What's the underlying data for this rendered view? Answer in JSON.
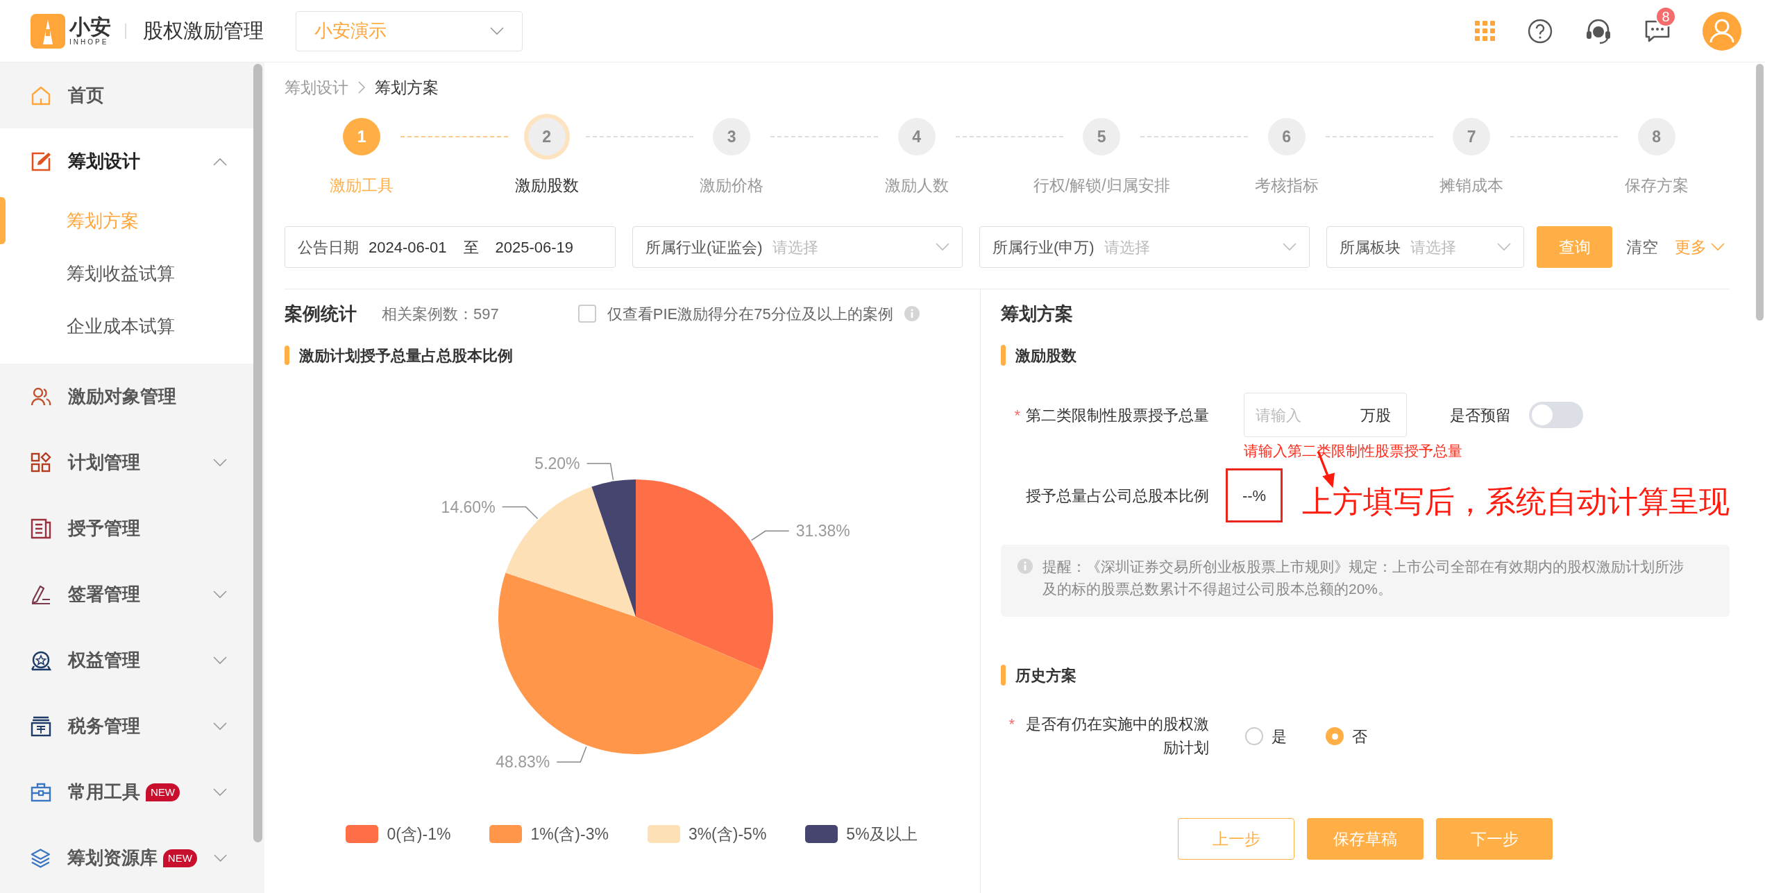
{
  "header": {
    "logo_text": "小安",
    "logo_subtext": "INHOPE",
    "app_title": "股权激励管理",
    "company_select": {
      "value": "小安演示"
    },
    "message_badge": "8"
  },
  "sidebar": {
    "items": [
      {
        "label": "首页",
        "kind": "link"
      },
      {
        "label": "筹划设计",
        "kind": "group",
        "expanded": true,
        "children": [
          {
            "label": "筹划方案",
            "selected": true
          },
          {
            "label": "筹划收益试算",
            "selected": false
          },
          {
            "label": "企业成本试算",
            "selected": false
          }
        ]
      },
      {
        "label": "激励对象管理",
        "kind": "link"
      },
      {
        "label": "计划管理",
        "kind": "group",
        "expanded": false
      },
      {
        "label": "授予管理",
        "kind": "link"
      },
      {
        "label": "签署管理",
        "kind": "group",
        "expanded": false
      },
      {
        "label": "权益管理",
        "kind": "group",
        "expanded": false
      },
      {
        "label": "税务管理",
        "kind": "group",
        "expanded": false
      },
      {
        "label": "常用工具",
        "kind": "group",
        "expanded": false,
        "badge": "NEW"
      },
      {
        "label": "筹划资源库",
        "kind": "group",
        "expanded": false,
        "badge": "NEW"
      }
    ]
  },
  "breadcrumb": [
    {
      "label": "筹划设计",
      "selected": false
    },
    {
      "label": "筹划方案",
      "selected": true
    }
  ],
  "steps": [
    {
      "number": "1",
      "label": "激励工具",
      "completed": true,
      "selected": false
    },
    {
      "number": "2",
      "label": "激励股数",
      "completed": false,
      "selected": true
    },
    {
      "number": "3",
      "label": "激励价格",
      "completed": false,
      "selected": false
    },
    {
      "number": "4",
      "label": "激励人数",
      "completed": false,
      "selected": false
    },
    {
      "number": "5",
      "label": "行权/解锁/归属安排",
      "completed": false,
      "selected": false
    },
    {
      "number": "6",
      "label": "考核指标",
      "completed": false,
      "selected": false
    },
    {
      "number": "7",
      "label": "摊销成本",
      "completed": false,
      "selected": false
    },
    {
      "number": "8",
      "label": "保存方案",
      "completed": false,
      "selected": false
    }
  ],
  "filters": {
    "date": {
      "label": "公告日期",
      "from": "2024-06-01",
      "separator": "至",
      "to": "2025-06-19"
    },
    "selects": [
      {
        "label": "所属行业(证监会)",
        "placeholder": "请选择"
      },
      {
        "label": "所属行业(申万)",
        "placeholder": "请选择"
      },
      {
        "label": "所属板块",
        "placeholder": "请选择"
      }
    ],
    "query_button": "查询",
    "clear_button": "清空",
    "more_button": "更多"
  },
  "case_stats": {
    "title": "案例统计",
    "count": "相关案例数：597",
    "checkbox": {
      "label": "仅查看PIE激励得分在75分位及以上的案例",
      "checked": false
    },
    "chart_title": "激励计划授予总量占总股本比例",
    "chart_data": {
      "type": "pie",
      "categories": [
        "0(含)-1%",
        "1%(含)-3%",
        "3%(含)-5%",
        "5%及以上"
      ],
      "series": [
        {
          "values": [
            31.38,
            48.83,
            14.6,
            5.2
          ]
        }
      ],
      "legend": "bottom",
      "colors": [
        "#ff6f47",
        "#ff964a",
        "#fde0b6",
        "#46456f"
      ],
      "value_labels": [
        "31.38%",
        "48.83%",
        "14.60%",
        "5.20%"
      ]
    }
  },
  "plan": {
    "title": "筹划方案",
    "section": "激励股数",
    "quantity_field": {
      "label": "第二类限制性股票授予总量",
      "required_mark": "*",
      "placeholder": "请输入",
      "unit": "万股"
    },
    "reserve_toggle": {
      "label": "是否预留",
      "on": false
    },
    "error": "请输入第二类限制性股票授予总量",
    "ratio": {
      "label": "授予总量占公司总股本比例",
      "value": "--%"
    },
    "annotation": "上方填写后，系统自动计算呈现",
    "tip": "提醒：《深圳证券交易所创业板股票上市规则》规定：上市公司全部在有效期内的股权激励计划所涉及的标的股票总数累计不得超过公司股本总额的20%。",
    "history_section": "历史方案",
    "history_question": {
      "label": "是否有仍在实施中的股权激励计划",
      "required_mark": "*",
      "options": [
        {
          "label": "是",
          "selected": false
        },
        {
          "label": "否",
          "selected": true
        }
      ]
    },
    "buttons": [
      {
        "label": "上一步",
        "kind": "outline"
      },
      {
        "label": "保存草稿",
        "kind": "solid"
      },
      {
        "label": "下一步",
        "kind": "solid"
      }
    ]
  }
}
